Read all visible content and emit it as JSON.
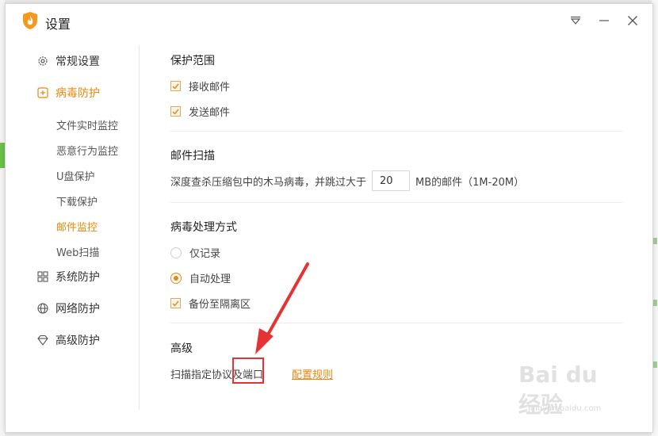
{
  "window": {
    "title": "设置"
  },
  "sidebar": {
    "items": [
      {
        "label": "常规设置"
      },
      {
        "label": "病毒防护"
      },
      {
        "label": "系统防护"
      },
      {
        "label": "网络防护"
      },
      {
        "label": "高级防护"
      }
    ],
    "sub_items": [
      {
        "label": "文件实时监控"
      },
      {
        "label": "恶意行为监控"
      },
      {
        "label": "U盘保护"
      },
      {
        "label": "下载保护"
      },
      {
        "label": "邮件监控"
      },
      {
        "label": "Web扫描"
      }
    ],
    "active_item": "病毒防护",
    "active_sub_item": "邮件监控"
  },
  "sections": {
    "protect_scope": {
      "title": "保护范围",
      "options": [
        {
          "label": "接收邮件",
          "checked": true
        },
        {
          "label": "发送邮件",
          "checked": true
        }
      ]
    },
    "mail_scan": {
      "title": "邮件扫描",
      "text_before": "深度查杀压缩包中的木马病毒，并跳过大于",
      "size_value": "20",
      "text_after": "MB的邮件（1M-20M）"
    },
    "virus_handling": {
      "title": "病毒处理方式",
      "radio_options": [
        {
          "label": "仅记录",
          "selected": false
        },
        {
          "label": "自动处理",
          "selected": true
        }
      ],
      "backup": {
        "label": "备份至隔离区",
        "checked": true
      }
    },
    "advanced": {
      "title": "高级",
      "scan_label": "扫描指定协议及端口",
      "config_link": "配置规则"
    }
  },
  "watermark": {
    "brand": "Bai du 经验",
    "url": "jingyan.baidu.com"
  },
  "colors": {
    "accent": "#e8880e",
    "annotation": "#e53232"
  }
}
